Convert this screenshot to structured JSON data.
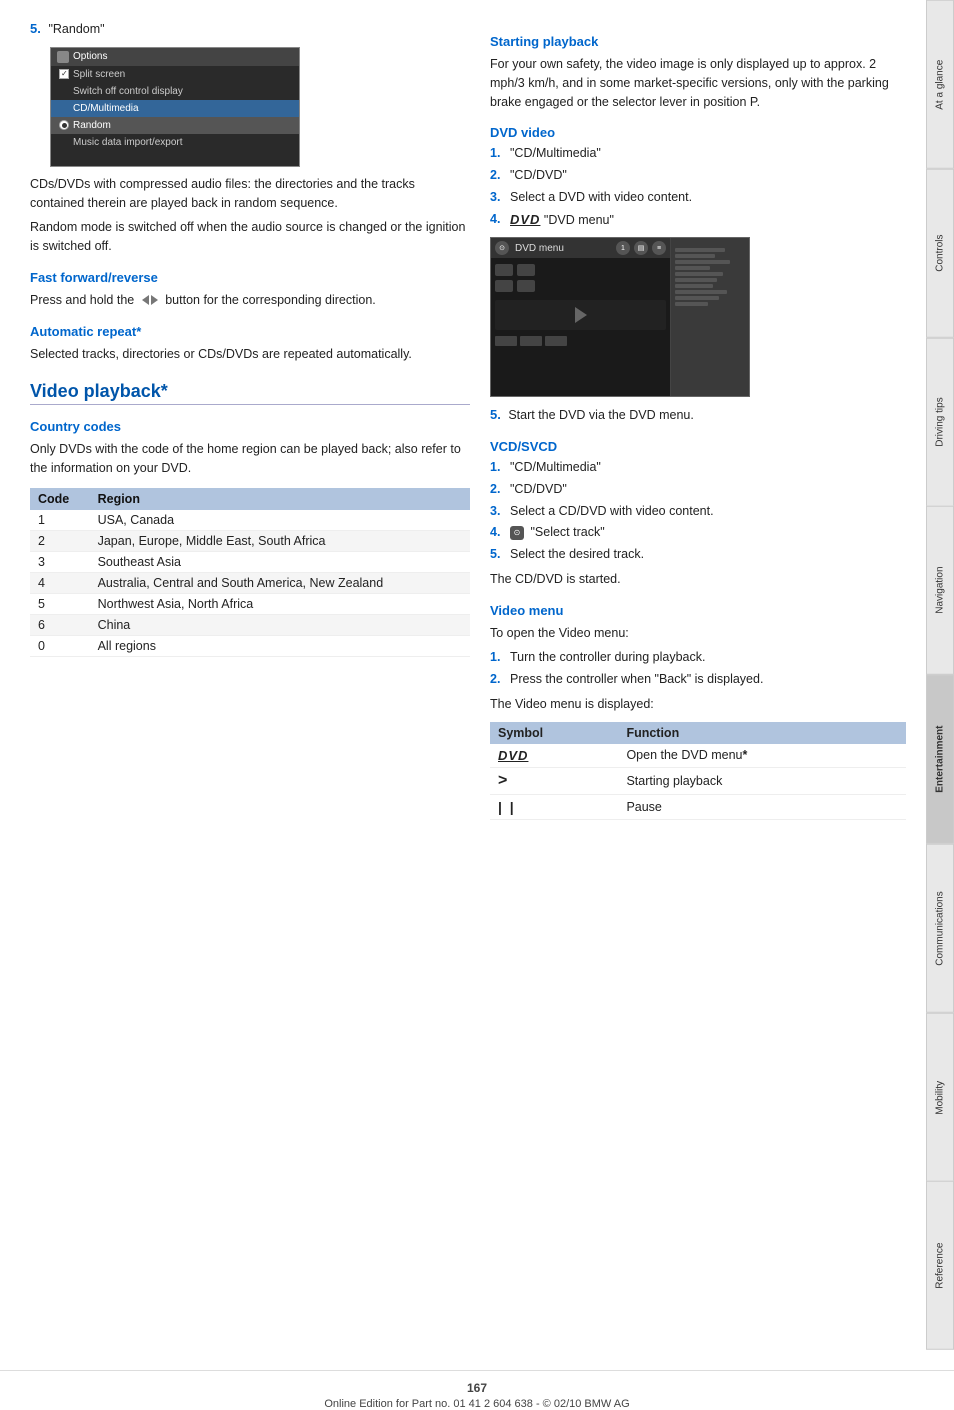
{
  "page": {
    "number": "167",
    "footer_text": "Online Edition for Part no. 01 41 2 604 638 - © 02/10 BMW AG"
  },
  "side_tabs": [
    {
      "id": "at-a-glance",
      "label": "At a glance",
      "active": false
    },
    {
      "id": "controls",
      "label": "Controls",
      "active": false
    },
    {
      "id": "driving-tips",
      "label": "Driving tips",
      "active": false
    },
    {
      "id": "navigation",
      "label": "Navigation",
      "active": false
    },
    {
      "id": "entertainment",
      "label": "Entertainment",
      "active": true
    },
    {
      "id": "communications",
      "label": "Communications",
      "active": false
    },
    {
      "id": "mobility",
      "label": "Mobility",
      "active": false
    },
    {
      "id": "reference",
      "label": "Reference",
      "active": false
    }
  ],
  "left_column": {
    "step5_label": "5.",
    "step5_text": "\"Random\"",
    "screenshot": {
      "title": "Options",
      "items": [
        {
          "label": "Split screen",
          "type": "checkbox",
          "checked": true
        },
        {
          "label": "Switch off control display",
          "type": "none",
          "highlighted": false
        },
        {
          "label": "CD/Multimedia",
          "type": "none",
          "highlighted": true
        },
        {
          "label": "Random",
          "type": "radio",
          "checked": true,
          "highlighted": true
        },
        {
          "label": "Music data import/export",
          "type": "none",
          "highlighted": false
        }
      ]
    },
    "body_text_1": "CDs/DVDs with compressed audio files: the directories and the tracks contained therein are played back in random sequence.",
    "body_text_2": "Random mode is switched off when the audio source is changed or the ignition is switched off.",
    "fast_forward_section": {
      "heading": "Fast forward/reverse",
      "body": "Press and hold the",
      "body2": "button for the corresponding direction."
    },
    "auto_repeat_section": {
      "heading": "Automatic repeat*",
      "body": "Selected tracks, directories or CDs/DVDs are repeated automatically."
    },
    "video_playback_section": {
      "title": "Video playback*",
      "country_codes_heading": "Country codes",
      "country_codes_body": "Only DVDs with the code of the home region can be played back; also refer to the information on your DVD.",
      "table": {
        "headers": [
          "Code",
          "Region"
        ],
        "rows": [
          {
            "code": "1",
            "region": "USA, Canada"
          },
          {
            "code": "2",
            "region": "Japan, Europe, Middle East, South Africa"
          },
          {
            "code": "3",
            "region": "Southeast Asia"
          },
          {
            "code": "4",
            "region": "Australia, Central and South America, New Zealand"
          },
          {
            "code": "5",
            "region": "Northwest Asia, North Africa"
          },
          {
            "code": "6",
            "region": "China"
          },
          {
            "code": "0",
            "region": "All regions"
          }
        ]
      }
    }
  },
  "right_column": {
    "starting_playback_section": {
      "heading": "Starting playback",
      "body": "For your own safety, the video image is only displayed up to approx. 2 mph/3 km/h, and in some market-specific versions, only with the parking brake engaged or the selector lever in position P."
    },
    "dvd_video_section": {
      "heading": "DVD video",
      "steps": [
        {
          "num": "1.",
          "text": "\"CD/Multimedia\""
        },
        {
          "num": "2.",
          "text": "\"CD/DVD\""
        },
        {
          "num": "3.",
          "text": "Select a DVD with video content."
        },
        {
          "num": "4.",
          "text": "\"DVD menu\"",
          "has_dvd_logo": true
        }
      ],
      "step5_label": "5.",
      "step5_text": "Start the DVD via the DVD menu."
    },
    "vcd_svcd_section": {
      "heading": "VCD/SVCD",
      "steps": [
        {
          "num": "1.",
          "text": "\"CD/Multimedia\""
        },
        {
          "num": "2.",
          "text": "\"CD/DVD\""
        },
        {
          "num": "3.",
          "text": "Select a CD/DVD with video content."
        },
        {
          "num": "4.",
          "text": "\"Select track\"",
          "has_controller_icon": true
        },
        {
          "num": "5.",
          "text": "Select the desired track."
        }
      ],
      "body": "The CD/DVD is started."
    },
    "video_menu_section": {
      "heading": "Video menu",
      "intro": "To open the Video menu:",
      "steps": [
        {
          "num": "1.",
          "text": "Turn the controller during playback."
        },
        {
          "num": "2.",
          "text": "Press the controller when \"Back\" is displayed."
        }
      ],
      "result": "The Video menu is displayed:",
      "symbol_table": {
        "headers": [
          "Symbol",
          "Function"
        ],
        "rows": [
          {
            "symbol": "DVD",
            "function": "Open the DVD menu*",
            "bold_asterisk": true
          },
          {
            "symbol": ">",
            "function": "Starting playback"
          },
          {
            "symbol": "||",
            "function": "Pause"
          }
        ]
      }
    }
  }
}
